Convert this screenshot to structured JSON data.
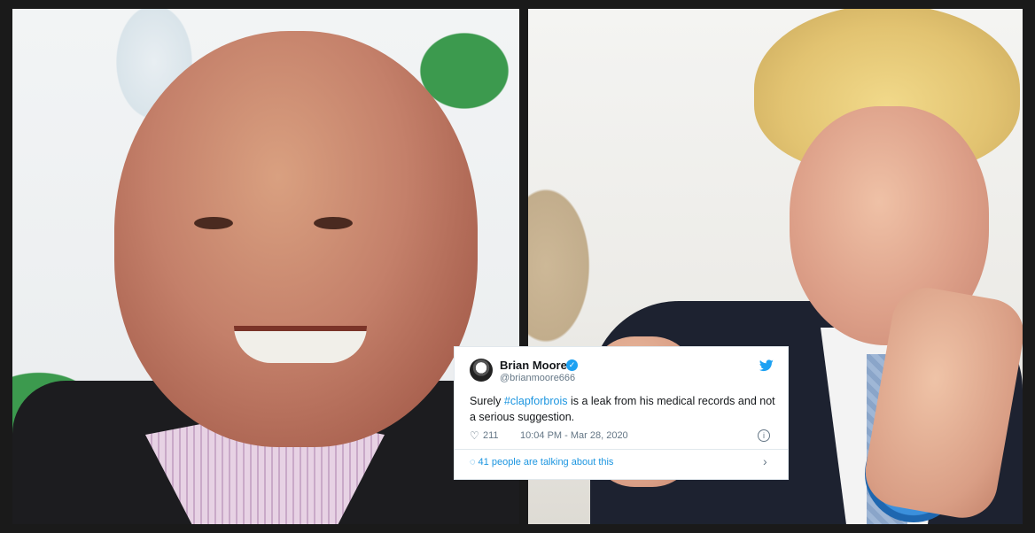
{
  "tweet": {
    "display_name": "Brian Moore",
    "handle": "@brianmoore666",
    "text_before": "Surely ",
    "hashtag": "#clapforbrois",
    "text_after": " is a leak from his medical records and not a serious suggestion.",
    "likes": "211",
    "timestamp": "10:04 PM - Mar 28, 2020",
    "conversation": "41 people are talking about this",
    "verified_mark": "✓",
    "info_mark": "i",
    "chevron": "›",
    "heart_glyph": "♡",
    "bubble_glyph": "◌"
  },
  "colors": {
    "accent": "#1da1f2",
    "link": "#1b95e0",
    "muted": "#657786"
  },
  "icons": [
    "avatar",
    "verified-icon",
    "twitter-bird-icon",
    "heart-icon",
    "info-icon",
    "comment-bubble-icon",
    "chevron-right-icon"
  ]
}
